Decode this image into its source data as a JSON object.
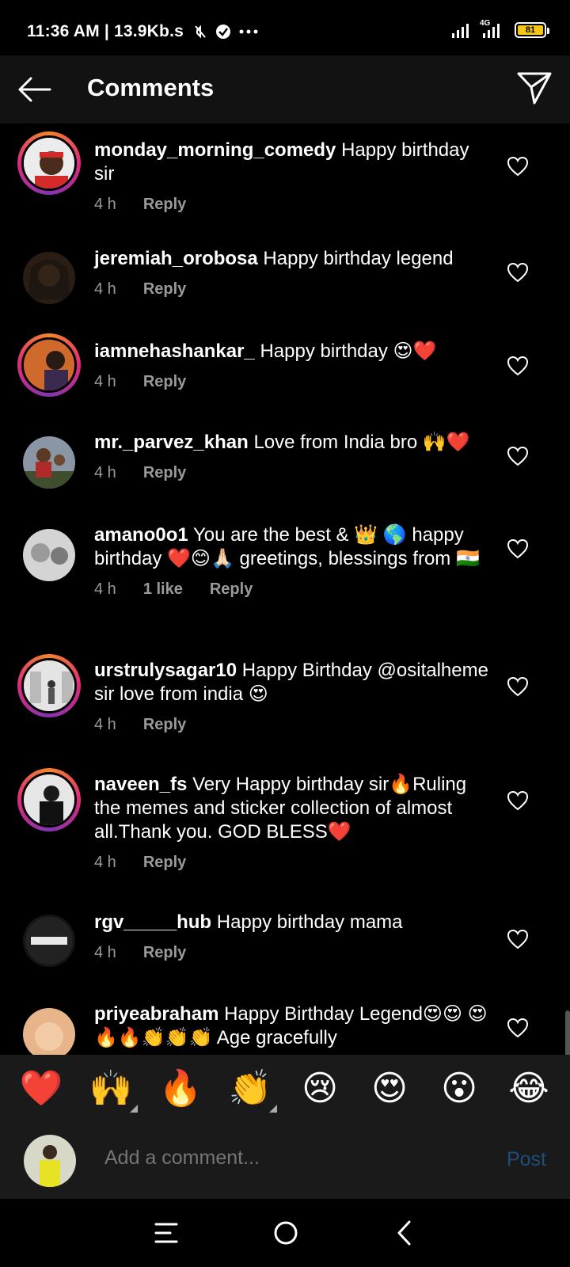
{
  "status_bar": {
    "time_speed": "11:36 AM | 13.9Kb.s",
    "network_label": "4G",
    "battery": "81"
  },
  "header": {
    "title": "Comments"
  },
  "comments": [
    {
      "username": "monday_morning_comedy",
      "text": "Happy birthday sir",
      "time": "4 h",
      "likes": "",
      "reply": "Reply",
      "story_ring": true,
      "avatar_color": "#e8e8e8"
    },
    {
      "username": "jeremiah_orobosa",
      "text": "Happy birthday legend",
      "time": "4 h",
      "likes": "",
      "reply": "Reply",
      "story_ring": false,
      "avatar_color": "#3a2a1a"
    },
    {
      "username": "iamnehashankar_",
      "text": "Happy birthday 😍❤️",
      "time": "4 h",
      "likes": "",
      "reply": "Reply",
      "story_ring": true,
      "avatar_color": "#c8642a"
    },
    {
      "username": "mr._parvez_khan",
      "text": "Love from India bro 🙌❤️",
      "time": "4 h",
      "likes": "",
      "reply": "Reply",
      "story_ring": false,
      "avatar_color": "#7a8a9a"
    },
    {
      "username": "amano0o1",
      "text": "You are the best & 👑 🌎 happy birthday ❤️😊🙏🏻 greetings, blessings from 🇮🇳",
      "time": "4 h",
      "likes": "1 like",
      "reply": "Reply",
      "story_ring": false,
      "avatar_color": "#cfcfcf"
    },
    {
      "username": "urstrulysagar10",
      "text": "Happy Birthday @osita​lheme sir love from india 😍",
      "time": "4 h",
      "likes": "",
      "reply": "Reply",
      "story_ring": true,
      "avatar_color": "#dcdcdc"
    },
    {
      "username": "naveen_fs",
      "text": "Very Happy birthday sir🔥Ruling the memes and sticker collection of almost all.Thank you. GOD BLESS❤️",
      "time": "4 h",
      "likes": "",
      "reply": "Reply",
      "story_ring": true,
      "avatar_color": "#1e1e1e"
    },
    {
      "username": "rgv_____hub",
      "text": "Happy birthday mama",
      "time": "4 h",
      "likes": "",
      "reply": "Reply",
      "story_ring": false,
      "avatar_color": "#111111"
    },
    {
      "username": "priyeabraham",
      "text": "Happy Birthday Legend😍😍 😍🔥🔥👏👏👏 Age gracefully",
      "time": "",
      "likes": "",
      "reply": "",
      "story_ring": false,
      "avatar_color": "#e8b48a"
    }
  ],
  "emoji_bar": [
    "❤️",
    "🙌",
    "🔥",
    "👏",
    "😢",
    "😍",
    "😮",
    "😂"
  ],
  "compose": {
    "placeholder": "Add a comment...",
    "post_label": "Post"
  }
}
